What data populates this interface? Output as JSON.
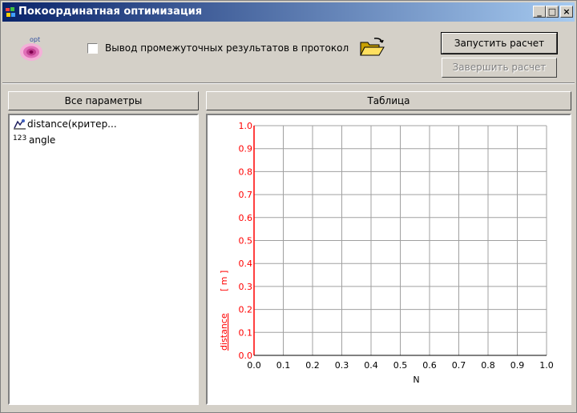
{
  "window": {
    "title": "Покоординатная оптимизация"
  },
  "titlebar_buttons": {
    "minimize": "_",
    "maximize": "□",
    "close": "×"
  },
  "toolbar": {
    "opt_icon_label": "opt",
    "checkbox_label": "Вывод промежуточных результатов в протокол",
    "checkbox_checked": false,
    "run_button": "Запустить расчет",
    "stop_button": "Завершить расчет"
  },
  "tabs": {
    "params_header": "Все параметры",
    "table_header": "Таблица"
  },
  "params_list": [
    {
      "icon": "criterion-icon",
      "label": "distance(критер..."
    },
    {
      "icon": "number-icon",
      "icon_text": "123",
      "label": "angle"
    }
  ],
  "chart_data": {
    "type": "line",
    "ylabel": "distance",
    "yunit": "[ m ]",
    "xlabel": "N",
    "xlim": [
      0,
      1
    ],
    "ylim": [
      0,
      1
    ],
    "xticks": [
      "0.0",
      "0.1",
      "0.2",
      "0.3",
      "0.4",
      "0.5",
      "0.6",
      "0.7",
      "0.8",
      "0.9",
      "1.0"
    ],
    "yticks": [
      "0.0",
      "0.1",
      "0.2",
      "0.3",
      "0.4",
      "0.5",
      "0.6",
      "0.7",
      "0.8",
      "0.9",
      "1.0"
    ],
    "grid": true,
    "series": []
  },
  "colors": {
    "axis_red": "#ff0000",
    "title_start": "#0a246a",
    "title_end": "#a6caf0"
  }
}
